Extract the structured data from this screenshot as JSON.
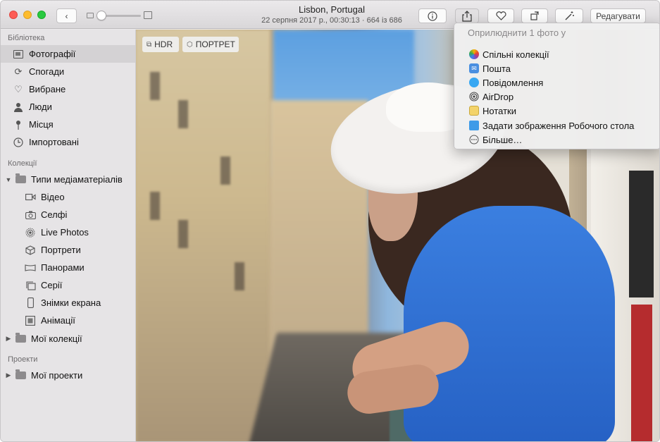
{
  "toolbar": {
    "title": "Lisbon, Portugal",
    "subtitle": "22 серпня 2017 р., 00:30:13  ·  664 із 686",
    "edit_label": "Редагувати"
  },
  "sidebar": {
    "library_title": "Бібліотека",
    "library_items": [
      {
        "label": "Фотографії",
        "icon": "photos-icon"
      },
      {
        "label": "Спогади",
        "icon": "memories-icon"
      },
      {
        "label": "Вибране",
        "icon": "heart-icon"
      },
      {
        "label": "Люди",
        "icon": "person-icon"
      },
      {
        "label": "Місця",
        "icon": "pin-icon"
      },
      {
        "label": "Імпортовані",
        "icon": "clock-icon"
      }
    ],
    "collections_title": "Колекції",
    "media_types_label": "Типи медіаматеріалів",
    "media_items": [
      {
        "label": "Відео",
        "icon": "video-icon"
      },
      {
        "label": "Селфі",
        "icon": "camera-icon"
      },
      {
        "label": "Live Photos",
        "icon": "live-photo-icon"
      },
      {
        "label": "Портрети",
        "icon": "cube-icon"
      },
      {
        "label": "Панорами",
        "icon": "panorama-icon"
      },
      {
        "label": "Серії",
        "icon": "burst-icon"
      },
      {
        "label": "Знімки екрана",
        "icon": "phone-icon"
      },
      {
        "label": "Анімації",
        "icon": "animation-icon"
      }
    ],
    "my_collections_label": "Мої колекції",
    "projects_title": "Проекти",
    "my_projects_label": "Мої проекти"
  },
  "photo": {
    "tag_hdr": "HDR",
    "tag_portrait": "ПОРТРЕТ"
  },
  "share_menu": {
    "header": "Оприлюднити 1 фото у",
    "items": [
      {
        "label": "Спільні колекції",
        "icon": "shared-albums-icon",
        "color": "#e8a23a"
      },
      {
        "label": "Пошта",
        "icon": "mail-icon",
        "color": "#4a8fe0"
      },
      {
        "label": "Повідомлення",
        "icon": "messages-icon",
        "color": "#37a7f2"
      },
      {
        "label": "AirDrop",
        "icon": "airdrop-icon",
        "color": "#555555"
      },
      {
        "label": "Нотатки",
        "icon": "notes-icon",
        "color": "#f3d36a"
      },
      {
        "label": "Задати зображення Робочого стола",
        "icon": "desktop-folder-icon",
        "color": "#3e9be8"
      },
      {
        "label": "Більше…",
        "icon": "more-icon",
        "color": "#8a8a8a"
      }
    ]
  },
  "colors": {
    "selection": "#d4d2d4",
    "sidebar_bg": "#e6e4e6"
  }
}
